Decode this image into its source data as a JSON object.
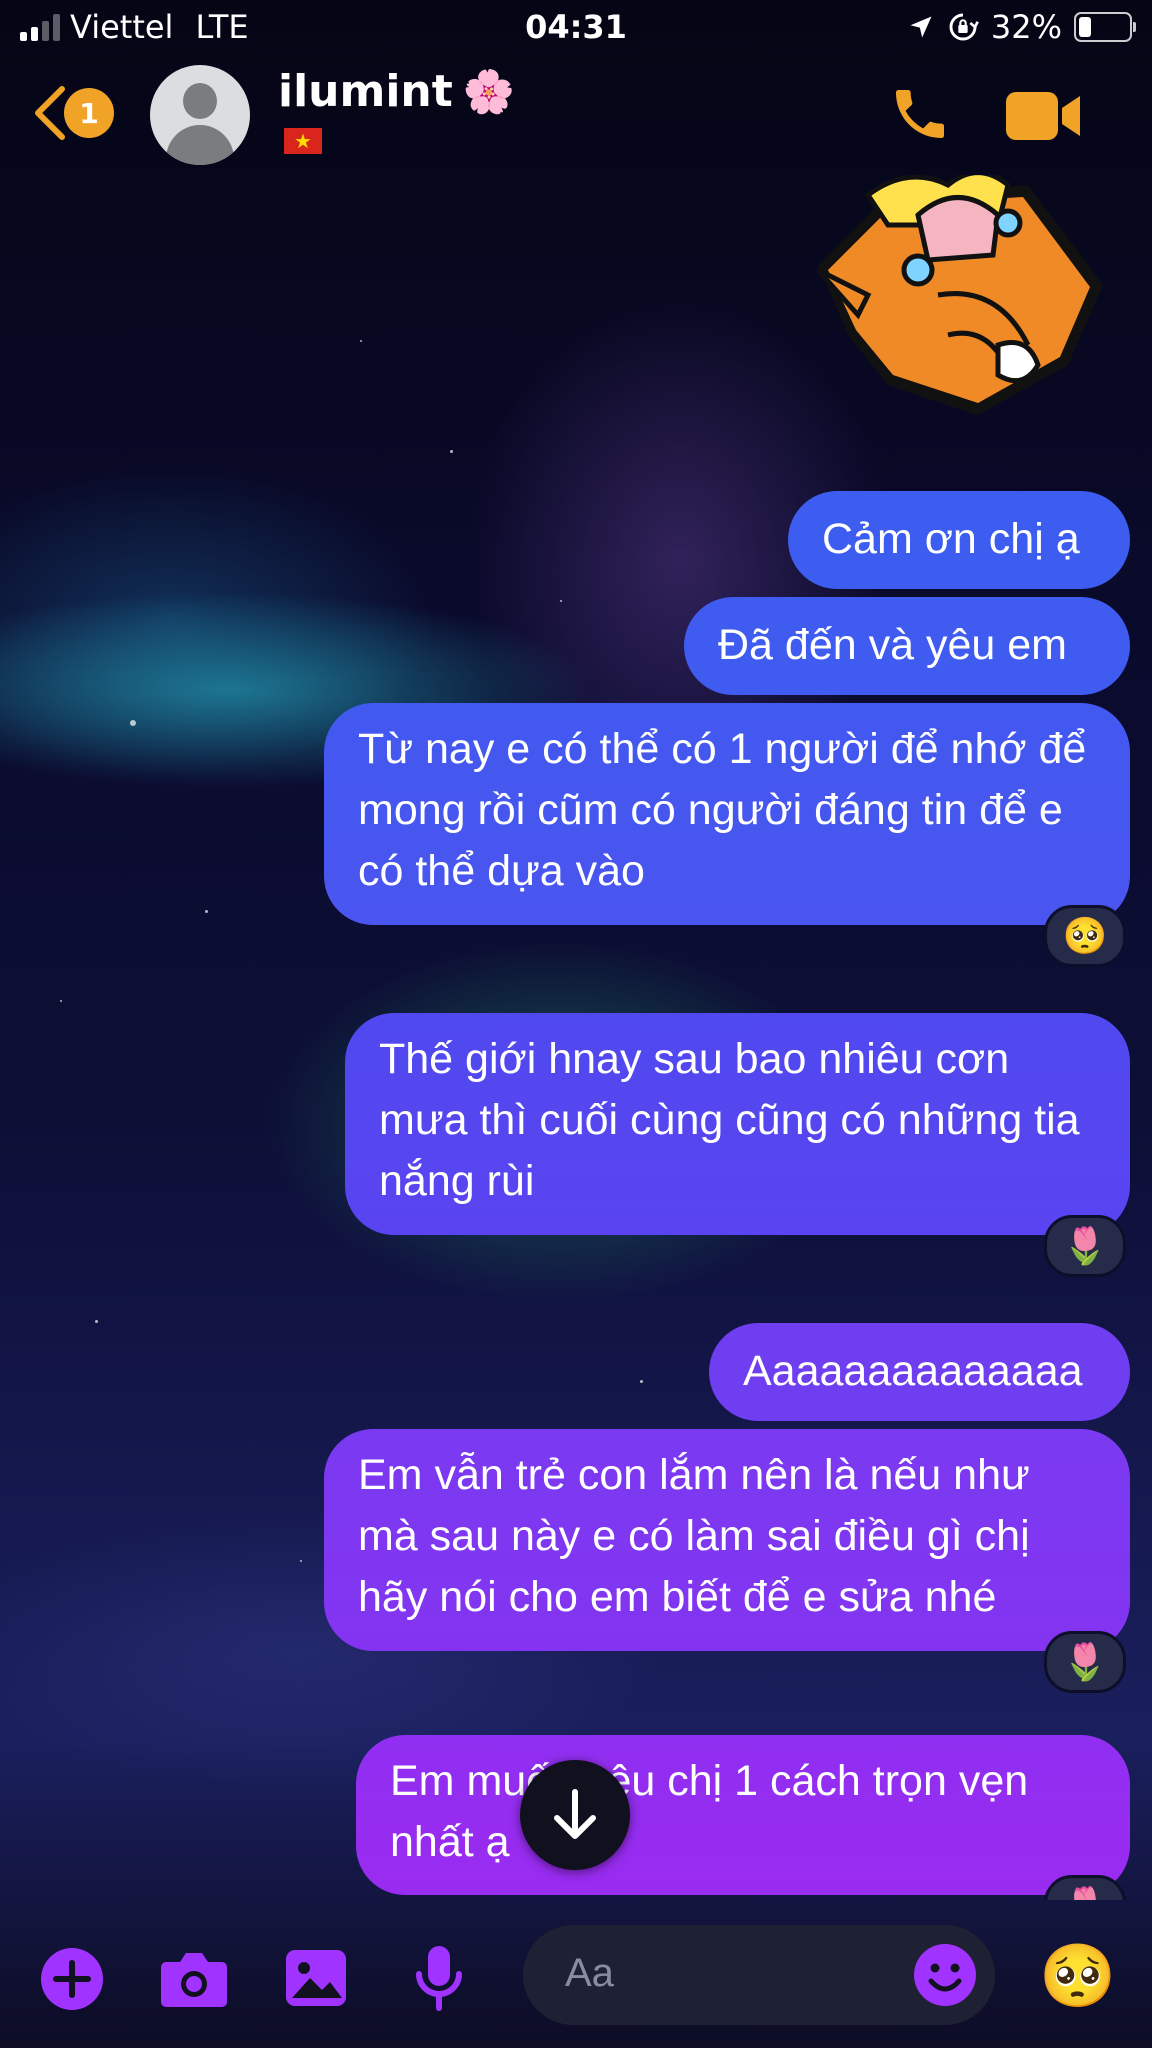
{
  "status_bar": {
    "carrier": "Viettel",
    "network": "LTE",
    "time": "04:31",
    "battery": "32%"
  },
  "header": {
    "unread_count": "1",
    "contact_name": "ilumint",
    "name_emoji": "🌸",
    "flag_icon": "vietnam-flag"
  },
  "messages": [
    {
      "text": "Cảm ơn chị ạ"
    },
    {
      "text": "Đã đến và yêu em"
    },
    {
      "text": "Từ nay e có thể có 1 người để nhớ để mong rồi cũm có người đáng tin để e có thể dựa vào",
      "reaction": "🥺"
    },
    {
      "text": "Thế giới hnay sau bao nhiêu cơn mưa thì cuối cùng cũng có những tia nắng rùi",
      "reaction": "🌷"
    },
    {
      "text": "Aaaaaaaaaaaaaa"
    },
    {
      "text": "Em vẫn trẻ con lắm nên là nếu như mà sau này e có làm sai điều gì chị hãy nói cho em biết để e sửa nhé",
      "reaction": "🌷"
    },
    {
      "text": "Em muốn yêu chị 1 cách trọn vẹn nhất ạ",
      "reaction": "🌷"
    }
  ],
  "composer": {
    "placeholder": "Aa",
    "quick_reaction": "🥺"
  },
  "colors": {
    "accent": "#f0a326",
    "composer_icon": "#a033ff",
    "bubble_top": "#3b5ff0",
    "bubble_bottom": "#9a2bf0"
  }
}
